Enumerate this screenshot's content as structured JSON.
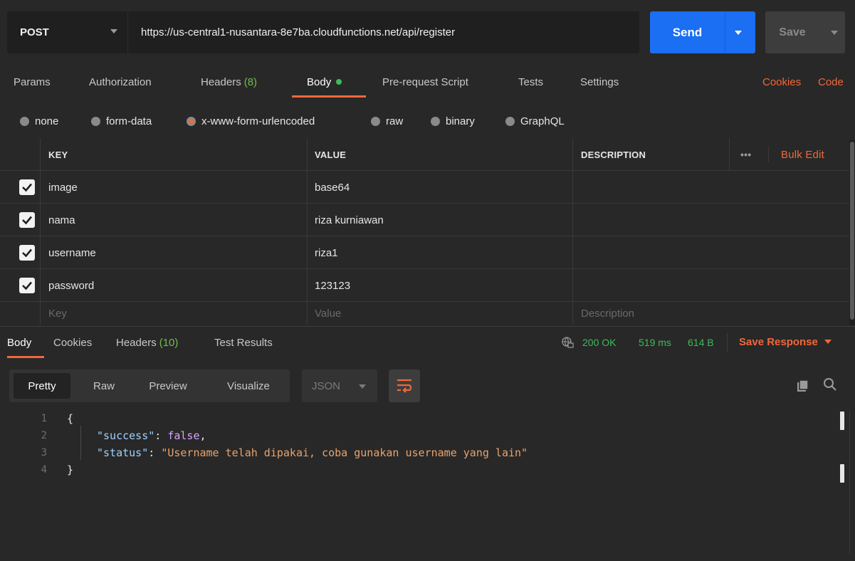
{
  "request": {
    "method": "POST",
    "url": "https://us-central1-nusantara-8e7ba.cloudfunctions.net/api/register",
    "send_label": "Send",
    "save_label": "Save"
  },
  "req_tabs": {
    "params": "Params",
    "authorization": "Authorization",
    "headers": "Headers",
    "headers_count": "(8)",
    "body": "Body",
    "prerequest": "Pre-request Script",
    "tests": "Tests",
    "settings": "Settings",
    "cookies": "Cookies",
    "code": "Code"
  },
  "body_types": {
    "none": "none",
    "form_data": "form-data",
    "urlencoded": "x-www-form-urlencoded",
    "raw": "raw",
    "binary": "binary",
    "graphql": "GraphQL",
    "selected": "x-www-form-urlencoded"
  },
  "table": {
    "headers": {
      "key": "KEY",
      "value": "VALUE",
      "description": "DESCRIPTION",
      "more": "•••",
      "bulk_edit": "Bulk Edit"
    },
    "rows": [
      {
        "checked": true,
        "key": "image",
        "value": "base64",
        "description": ""
      },
      {
        "checked": true,
        "key": "nama",
        "value": "riza kurniawan",
        "description": ""
      },
      {
        "checked": true,
        "key": "username",
        "value": "riza1",
        "description": ""
      },
      {
        "checked": true,
        "key": "password",
        "value": "123123",
        "description": ""
      }
    ],
    "placeholders": {
      "key": "Key",
      "value": "Value",
      "description": "Description"
    }
  },
  "response": {
    "tabs": {
      "body": "Body",
      "cookies": "Cookies",
      "headers": "Headers",
      "headers_count": "(10)",
      "tests": "Test Results"
    },
    "status": "200 OK",
    "time": "519 ms",
    "size": "614 B",
    "save_response": "Save Response",
    "views": {
      "pretty": "Pretty",
      "raw": "Raw",
      "preview": "Preview",
      "visualize": "Visualize"
    },
    "format": "JSON",
    "code": {
      "lines": [
        "1",
        "2",
        "3",
        "4"
      ],
      "open": "{",
      "k1": "\"success\"",
      "v1": "false",
      "k2": "\"status\"",
      "v2": "\"Username telah dipakai, coba gunakan username yang lain\"",
      "close": "}"
    }
  },
  "colors": {
    "accent": "#f2683a",
    "send": "#1a6ff3",
    "ok": "#3dbb5a",
    "count": "#6fbf4f"
  }
}
